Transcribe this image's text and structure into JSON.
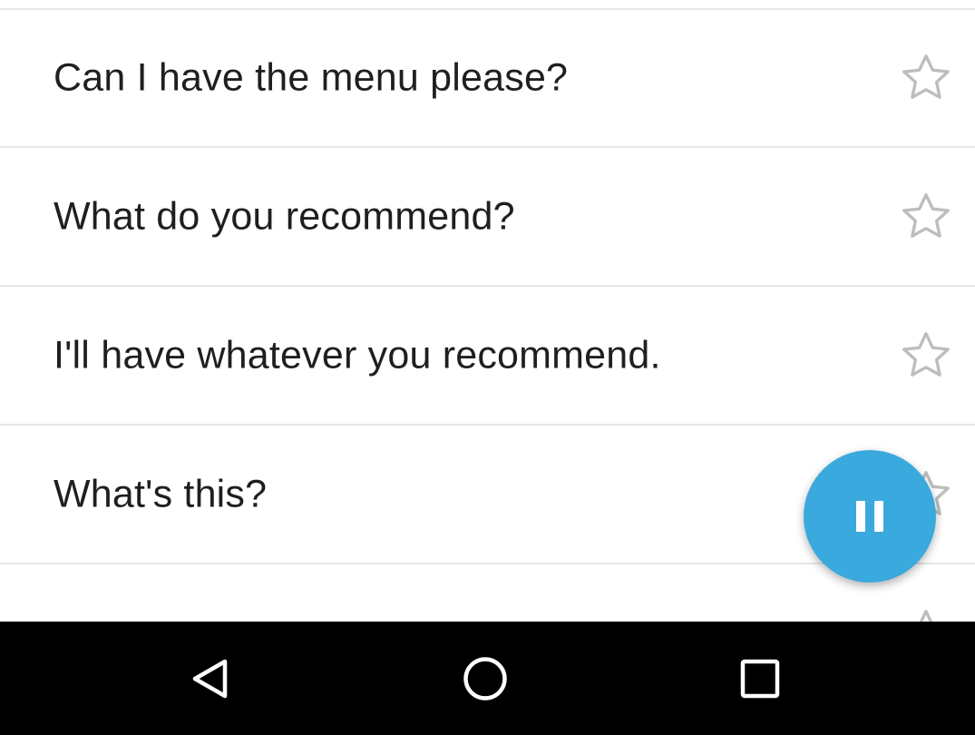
{
  "phrases": [
    {
      "text": "Can I have the menu please?",
      "favorite_icon": "star-outline-icon"
    },
    {
      "text": "What do you recommend?",
      "favorite_icon": "star-outline-icon"
    },
    {
      "text": "I'll have whatever you recommend.",
      "favorite_icon": "star-outline-icon"
    },
    {
      "text": "What's this?",
      "favorite_icon": "star-outline-icon"
    }
  ],
  "fab": {
    "icon": "pause-icon",
    "color": "#3aa9dd"
  },
  "nav_bar": {
    "back_icon": "back-triangle-icon",
    "home_icon": "home-circle-icon",
    "recents_icon": "recents-square-icon",
    "background": "#000000"
  },
  "colors": {
    "text": "#1f1f1f",
    "divider": "#e6e6e6",
    "star_outline": "#bdbdbd"
  }
}
